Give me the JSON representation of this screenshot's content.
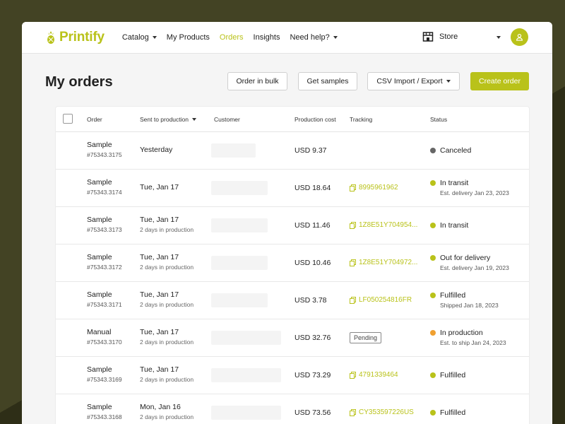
{
  "brand": {
    "name": "Printify",
    "accent": "#b9c21a"
  },
  "nav": [
    {
      "label": "Catalog",
      "dropdown": true,
      "active": false
    },
    {
      "label": "My Products",
      "dropdown": false,
      "active": false
    },
    {
      "label": "Orders",
      "dropdown": false,
      "active": true
    },
    {
      "label": "Insights",
      "dropdown": false,
      "active": false
    },
    {
      "label": "Need help?",
      "dropdown": true,
      "active": false
    }
  ],
  "store": {
    "label": "Store"
  },
  "page": {
    "title": "My orders",
    "buttons": {
      "order_bulk": "Order in bulk",
      "get_samples": "Get samples",
      "csv": "CSV Import / Export",
      "create": "Create order"
    }
  },
  "table": {
    "columns": {
      "order": "Order",
      "sent": "Sent to production",
      "customer": "Customer",
      "cost": "Production cost",
      "tracking": "Tracking",
      "status": "Status"
    },
    "rows": [
      {
        "type": "Sample",
        "id": "#75343.3175",
        "sent": "Yesterday",
        "sent_sub": "",
        "cost": "USD 9.37",
        "tracking": "",
        "pending": "",
        "status": "Canceled",
        "status_sub": "",
        "status_color": "#666666"
      },
      {
        "type": "Sample",
        "id": "#75343.3174",
        "sent": "Tue, Jan 17",
        "sent_sub": "",
        "cost": "USD 18.64",
        "tracking": "8995961962",
        "pending": "",
        "status": "In transit",
        "status_sub": "Est. delivery Jan 23, 2023",
        "status_color": "#b9c21a"
      },
      {
        "type": "Sample",
        "id": "#75343.3173",
        "sent": "Tue, Jan 17",
        "sent_sub": "2 days in production",
        "cost": "USD 11.46",
        "tracking": "1Z8E51Y704954...",
        "pending": "",
        "status": "In transit",
        "status_sub": "",
        "status_color": "#b9c21a"
      },
      {
        "type": "Sample",
        "id": "#75343.3172",
        "sent": "Tue, Jan 17",
        "sent_sub": "2 days in production",
        "cost": "USD 10.46",
        "tracking": "1Z8E51Y704972...",
        "pending": "",
        "status": "Out for delivery",
        "status_sub": "Est. delivery Jan 19, 2023",
        "status_color": "#b9c21a"
      },
      {
        "type": "Sample",
        "id": "#75343.3171",
        "sent": "Tue, Jan 17",
        "sent_sub": "2 days in production",
        "cost": "USD 3.78",
        "tracking": "LF050254816FR",
        "pending": "",
        "status": "Fulfilled",
        "status_sub": "Shipped Jan 18, 2023",
        "status_color": "#b9c21a"
      },
      {
        "type": "Manual",
        "id": "#75343.3170",
        "sent": "Tue, Jan 17",
        "sent_sub": "2 days in production",
        "cost": "USD 32.76",
        "tracking": "",
        "pending": "Pending",
        "status": "In production",
        "status_sub": "Est. to ship Jan 24, 2023",
        "status_color": "#f0a030"
      },
      {
        "type": "Sample",
        "id": "#75343.3169",
        "sent": "Tue, Jan 17",
        "sent_sub": "2 days in production",
        "cost": "USD 73.29",
        "tracking": "4791339464",
        "pending": "",
        "status": "Fulfilled",
        "status_sub": "",
        "status_color": "#b9c21a"
      },
      {
        "type": "Sample",
        "id": "#75343.3168",
        "sent": "Mon, Jan 16",
        "sent_sub": "2 days in production",
        "cost": "USD 73.56",
        "tracking": "CY353597226US",
        "pending": "",
        "status": "Fulfilled",
        "status_sub": "",
        "status_color": "#b9c21a"
      }
    ]
  }
}
